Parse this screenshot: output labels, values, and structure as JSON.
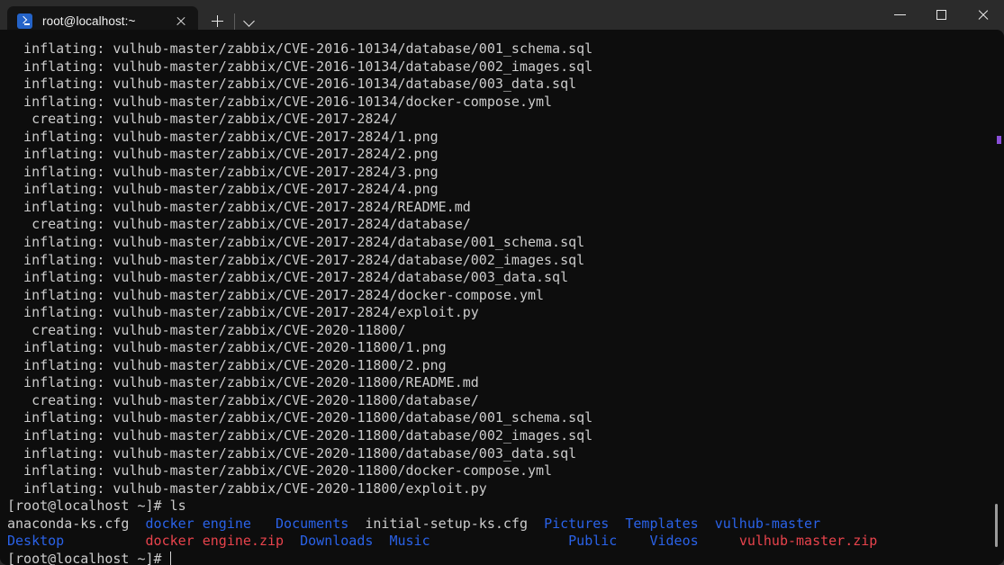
{
  "window": {
    "titlebar_bg": "#2b2b2b",
    "terminal_bg": "#0d0d0d",
    "controls": {
      "minimize_label": "─",
      "maximize_label": "□",
      "close_label": "✕"
    }
  },
  "tabs": [
    {
      "title": "root@localhost:~",
      "icon": "powershell-icon",
      "active": true,
      "close_label": "✕"
    }
  ],
  "tabstrip": {
    "new_tab_label": "+",
    "dropdown_label": "⌄"
  },
  "terminal": {
    "colors": {
      "foreground": "#cccccc",
      "background": "#0d0d0d",
      "blue": "#2a62e8",
      "red": "#e8434c",
      "cursor": "#d6d6d6",
      "scroll_mark": "#8a4fd8"
    },
    "cols": 107,
    "rows": 30,
    "lines": [
      {
        "type": "plain",
        "text": "  inflating: vulhub-master/zabbix/CVE-2016-10134/database/001_schema.sql"
      },
      {
        "type": "plain",
        "text": "  inflating: vulhub-master/zabbix/CVE-2016-10134/database/002_images.sql"
      },
      {
        "type": "plain",
        "text": "  inflating: vulhub-master/zabbix/CVE-2016-10134/database/003_data.sql"
      },
      {
        "type": "plain",
        "text": "  inflating: vulhub-master/zabbix/CVE-2016-10134/docker-compose.yml"
      },
      {
        "type": "plain",
        "text": "   creating: vulhub-master/zabbix/CVE-2017-2824/"
      },
      {
        "type": "plain",
        "text": "  inflating: vulhub-master/zabbix/CVE-2017-2824/1.png"
      },
      {
        "type": "plain",
        "text": "  inflating: vulhub-master/zabbix/CVE-2017-2824/2.png"
      },
      {
        "type": "plain",
        "text": "  inflating: vulhub-master/zabbix/CVE-2017-2824/3.png"
      },
      {
        "type": "plain",
        "text": "  inflating: vulhub-master/zabbix/CVE-2017-2824/4.png"
      },
      {
        "type": "plain",
        "text": "  inflating: vulhub-master/zabbix/CVE-2017-2824/README.md"
      },
      {
        "type": "plain",
        "text": "   creating: vulhub-master/zabbix/CVE-2017-2824/database/"
      },
      {
        "type": "plain",
        "text": "  inflating: vulhub-master/zabbix/CVE-2017-2824/database/001_schema.sql"
      },
      {
        "type": "plain",
        "text": "  inflating: vulhub-master/zabbix/CVE-2017-2824/database/002_images.sql"
      },
      {
        "type": "plain",
        "text": "  inflating: vulhub-master/zabbix/CVE-2017-2824/database/003_data.sql"
      },
      {
        "type": "plain",
        "text": "  inflating: vulhub-master/zabbix/CVE-2017-2824/docker-compose.yml"
      },
      {
        "type": "plain",
        "text": "  inflating: vulhub-master/zabbix/CVE-2017-2824/exploit.py"
      },
      {
        "type": "plain",
        "text": "   creating: vulhub-master/zabbix/CVE-2020-11800/"
      },
      {
        "type": "plain",
        "text": "  inflating: vulhub-master/zabbix/CVE-2020-11800/1.png"
      },
      {
        "type": "plain",
        "text": "  inflating: vulhub-master/zabbix/CVE-2020-11800/2.png"
      },
      {
        "type": "plain",
        "text": "  inflating: vulhub-master/zabbix/CVE-2020-11800/README.md"
      },
      {
        "type": "plain",
        "text": "   creating: vulhub-master/zabbix/CVE-2020-11800/database/"
      },
      {
        "type": "plain",
        "text": "  inflating: vulhub-master/zabbix/CVE-2020-11800/database/001_schema.sql"
      },
      {
        "type": "plain",
        "text": "  inflating: vulhub-master/zabbix/CVE-2020-11800/database/002_images.sql"
      },
      {
        "type": "plain",
        "text": "  inflating: vulhub-master/zabbix/CVE-2020-11800/database/003_data.sql"
      },
      {
        "type": "plain",
        "text": "  inflating: vulhub-master/zabbix/CVE-2020-11800/docker-compose.yml"
      },
      {
        "type": "plain",
        "text": "  inflating: vulhub-master/zabbix/CVE-2020-11800/exploit.py"
      },
      {
        "type": "spans",
        "spans": [
          {
            "color": "white",
            "text": "[root@localhost ~]# ls"
          }
        ]
      },
      {
        "type": "spans",
        "spans": [
          {
            "color": "white",
            "text": "anaconda-ks.cfg"
          },
          {
            "color": "white",
            "text": "  "
          },
          {
            "color": "blue",
            "text": "docker engine"
          },
          {
            "color": "white",
            "text": "   "
          },
          {
            "color": "blue",
            "text": "Documents"
          },
          {
            "color": "white",
            "text": "  "
          },
          {
            "color": "white",
            "text": "initial-setup-ks.cfg"
          },
          {
            "color": "white",
            "text": "  "
          },
          {
            "color": "blue",
            "text": "Pictures"
          },
          {
            "color": "white",
            "text": "  "
          },
          {
            "color": "blue",
            "text": "Templates"
          },
          {
            "color": "white",
            "text": "  "
          },
          {
            "color": "blue",
            "text": "vulhub-master"
          }
        ]
      },
      {
        "type": "spans",
        "spans": [
          {
            "color": "blue",
            "text": "Desktop"
          },
          {
            "color": "white",
            "text": "          "
          },
          {
            "color": "red",
            "text": "docker engine.zip"
          },
          {
            "color": "white",
            "text": "  "
          },
          {
            "color": "blue",
            "text": "Downloads"
          },
          {
            "color": "white",
            "text": "  "
          },
          {
            "color": "blue",
            "text": "Music"
          },
          {
            "color": "white",
            "text": "                 "
          },
          {
            "color": "blue",
            "text": "Public"
          },
          {
            "color": "white",
            "text": "    "
          },
          {
            "color": "blue",
            "text": "Videos"
          },
          {
            "color": "white",
            "text": "     "
          },
          {
            "color": "red",
            "text": "vulhub-master.zip"
          }
        ]
      },
      {
        "type": "prompt",
        "spans": [
          {
            "color": "white",
            "text": "[root@localhost ~]# "
          }
        ],
        "cursor": true
      }
    ]
  }
}
